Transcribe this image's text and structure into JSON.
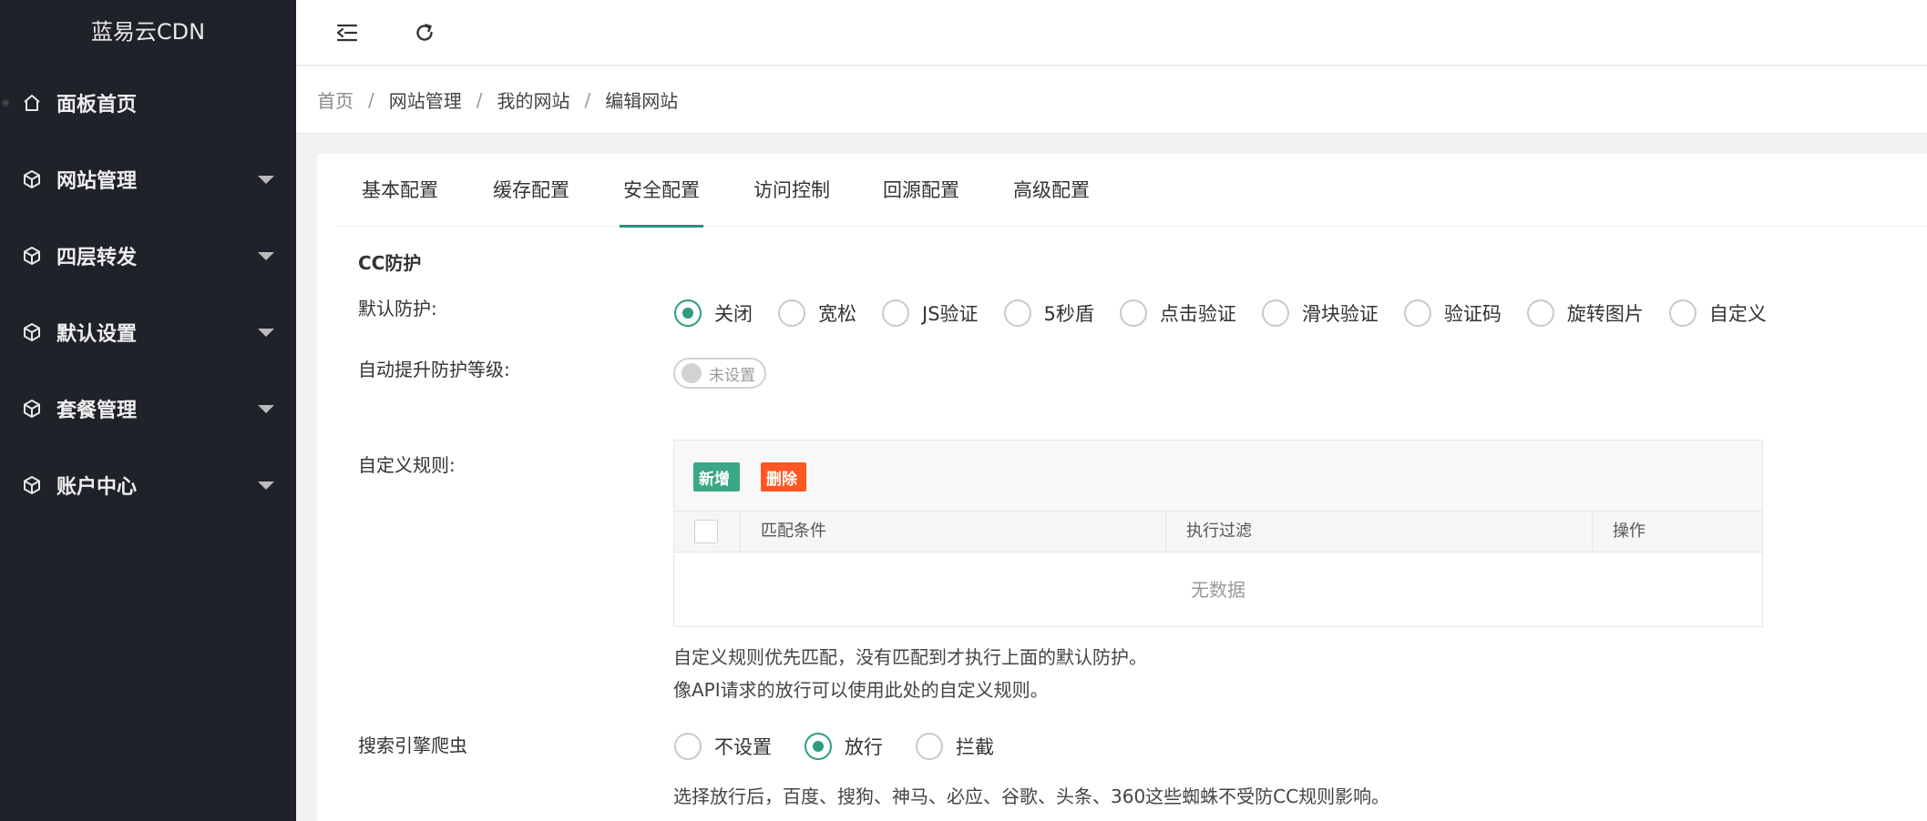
{
  "sidebar": {
    "brand": "蓝易云CDN",
    "items": [
      {
        "label": "面板首页",
        "icon": "home-icon",
        "has_arrow": false
      },
      {
        "label": "网站管理",
        "icon": "cube-icon",
        "has_arrow": true
      },
      {
        "label": "四层转发",
        "icon": "cube-icon",
        "has_arrow": true
      },
      {
        "label": "默认设置",
        "icon": "cube-icon",
        "has_arrow": true
      },
      {
        "label": "套餐管理",
        "icon": "cube-icon",
        "has_arrow": true
      },
      {
        "label": "账户中心",
        "icon": "cube-icon",
        "has_arrow": true
      }
    ]
  },
  "topbar": {
    "tools": [
      "menu-collapse-icon",
      "refresh-icon"
    ]
  },
  "breadcrumb": [
    "首页",
    "网站管理",
    "我的网站",
    "编辑网站"
  ],
  "tabs": [
    {
      "label": "基本配置",
      "active": false
    },
    {
      "label": "缓存配置",
      "active": false
    },
    {
      "label": "安全配置",
      "active": true
    },
    {
      "label": "访问控制",
      "active": false
    },
    {
      "label": "回源配置",
      "active": false
    },
    {
      "label": "高级配置",
      "active": false
    }
  ],
  "cc": {
    "section_title": "CC防护",
    "default_label": "默认防护:",
    "default_options": [
      "关闭",
      "宽松",
      "JS验证",
      "5秒盾",
      "点击验证",
      "滑块验证",
      "验证码",
      "旋转图片",
      "自定义"
    ],
    "default_selected": "关闭",
    "auto_label": "自动提升防护等级:",
    "auto_switch_text": "未设置",
    "custom_label": "自定义规则:",
    "add_button": "新增",
    "delete_button": "删除",
    "columns": [
      "匹配条件",
      "执行过滤",
      "操作"
    ],
    "empty_text": "无数据",
    "hint_line1": "自定义规则优先匹配，没有匹配到才执行上面的默认防护。",
    "hint_line2": "像API请求的放行可以使用此处的自定义规则。",
    "spider_label": "搜索引擎爬虫",
    "spider_options": [
      "不设置",
      "放行",
      "拦截"
    ],
    "spider_selected": "放行",
    "spider_hint": "选择放行后，百度、搜狗、神马、必应、谷歌、头条、360这些蜘蛛不受防CC规则影响。"
  },
  "colors": {
    "sidebar_bg": "#20222a",
    "accent": "#2d9c80",
    "add_btn": "#3aa886",
    "delete_btn": "#ff5722"
  }
}
